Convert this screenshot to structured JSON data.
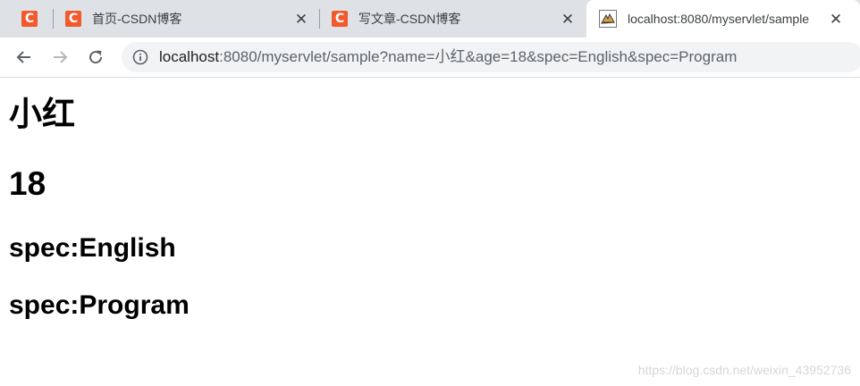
{
  "tabs": [
    {
      "title": "",
      "favicon": "csdn-c-icon"
    },
    {
      "title": "首页-CSDN博客",
      "favicon": "csdn-c-icon"
    },
    {
      "title": "写文章-CSDN博客",
      "favicon": "csdn-c-icon"
    },
    {
      "title": "localhost:8080/myservlet/sample",
      "favicon": "tomcat-icon",
      "active": true
    }
  ],
  "close_glyph": "✕",
  "address_bar": {
    "host": "localhost",
    "rest": ":8080/myservlet/sample?name=小红&age=18&spec=English&spec=Program"
  },
  "page": {
    "name": "小红",
    "age": "18",
    "specs": [
      "spec:English",
      "spec:Program"
    ]
  },
  "watermark": "https://blog.csdn.net/weixin_43952736",
  "colors": {
    "csdn_brand": "#f25a2d",
    "tab_strip": "#dee1e6",
    "omnibox": "#f1f3f4"
  }
}
